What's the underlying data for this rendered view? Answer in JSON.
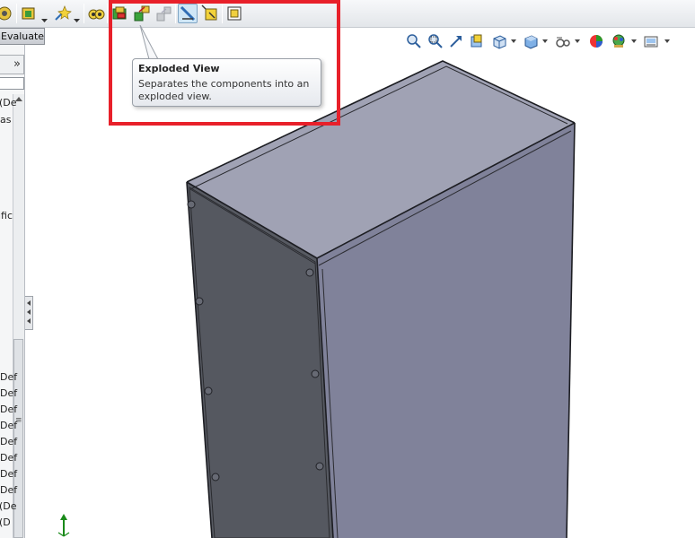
{
  "command_manager": {
    "active_tab": "Evaluate"
  },
  "toolbar": {
    "buttons": [
      "assembly-features-icon",
      "smart-fasteners-icon",
      "reference-geometry-icon",
      "bill-of-materials-icon",
      "assembly-icon",
      "exploded-view-icon",
      "explode-line-sketch-icon",
      "interference-detection-icon",
      "move-component-icon",
      "instant3d-icon"
    ],
    "pressed": "interference-detection-icon"
  },
  "tooltip": {
    "title": "Exploded View",
    "body": "Separates the components into an exploded view."
  },
  "feature_tree_fragments": [
    "(De",
    "as",
    "ific",
    "Def",
    "Def",
    "Def",
    "Def",
    "Def",
    "Def",
    "Def",
    "Def",
    "(De",
    "(D"
  ],
  "panel": {
    "expand_glyph": "»"
  },
  "heads_up_toolbar": [
    "zoom-to-fit-icon",
    "zoom-to-area-icon",
    "previous-view-icon",
    "section-view-icon",
    "view-orientation-icon",
    "display-style-icon",
    "hide-show-items-icon",
    "edit-appearance-icon",
    "apply-scene-icon",
    "view-settings-icon"
  ],
  "colors": {
    "highlight": "#e8202a",
    "model_front": "#7f8194",
    "model_side": "#53565e",
    "model_top": "#9a9cae"
  }
}
